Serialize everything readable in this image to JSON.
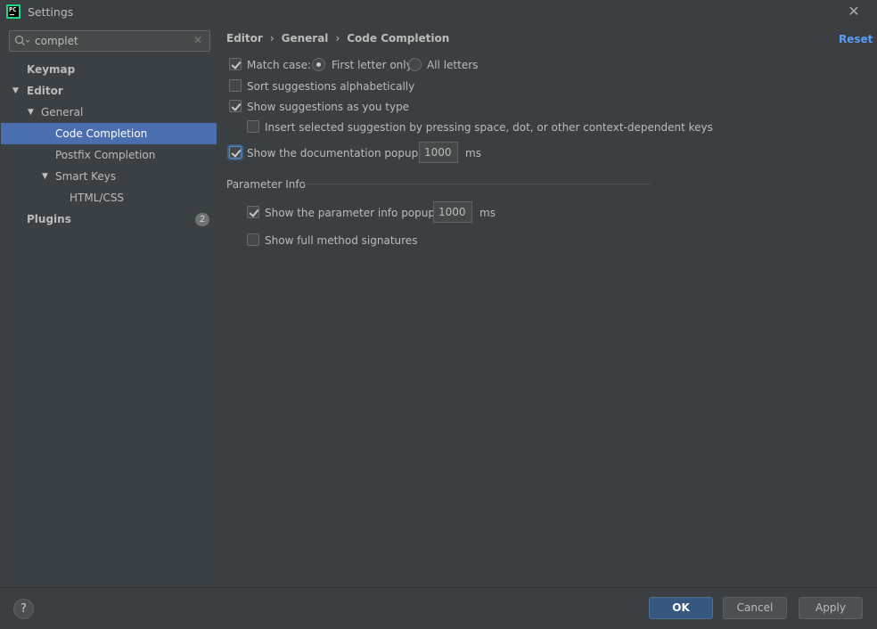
{
  "window": {
    "title": "Settings",
    "logo_text": "PC",
    "close_glyph": "✕"
  },
  "search": {
    "value": "complet",
    "placeholder": ""
  },
  "tree": {
    "keymap": "Keymap",
    "editor": "Editor",
    "general": "General",
    "code_completion": "Code Completion",
    "postfix_completion": "Postfix Completion",
    "smart_keys": "Smart Keys",
    "html_css": "HTML/CSS",
    "plugins": "Plugins",
    "plugins_badge": "2"
  },
  "breadcrumb": [
    "Editor",
    "General",
    "Code Completion"
  ],
  "breadcrumb_sep": "›",
  "reset_label": "Reset",
  "options": {
    "match_case": {
      "label": "Match case:",
      "checked": true
    },
    "first_letter": {
      "label": "First letter only",
      "selected": true
    },
    "all_letters": {
      "label": "All letters",
      "selected": false
    },
    "sort_alpha": {
      "label": "Sort suggestions alphabetically",
      "checked": false
    },
    "show_as_type": {
      "label": "Show suggestions as you type",
      "checked": true
    },
    "insert_selected": {
      "label": "Insert selected suggestion by pressing space, dot, or other context-dependent keys",
      "checked": false
    },
    "doc_popup": {
      "label": "Show the documentation popup in",
      "checked": true,
      "value": "1000",
      "unit": "ms"
    }
  },
  "parameter_info": {
    "title": "Parameter Info",
    "param_popup": {
      "label": "Show the parameter info popup in",
      "checked": true,
      "value": "1000",
      "unit": "ms"
    },
    "full_signatures": {
      "label": "Show full method signatures",
      "checked": false
    }
  },
  "footer": {
    "help": "?",
    "ok": "OK",
    "cancel": "Cancel",
    "apply": "Apply"
  },
  "colors": {
    "accent": "#4b6eaf",
    "link": "#589df6",
    "primary_button": "#365880"
  }
}
